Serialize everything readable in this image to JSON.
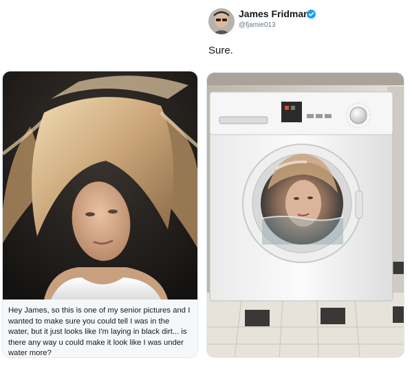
{
  "tweet": {
    "display_name": "James Fridman",
    "handle": "@fjamie013",
    "text": "Sure.",
    "verified_icon": "verified-badge-icon",
    "accent_color": "#1da1f2"
  },
  "request": {
    "caption": "Hey James, so this is one of my senior pictures and I wanted to make sure you could tell I was in the water, but it just looks like I'm laying in black dirt... is there any way u could make it look like I was under water more?"
  }
}
